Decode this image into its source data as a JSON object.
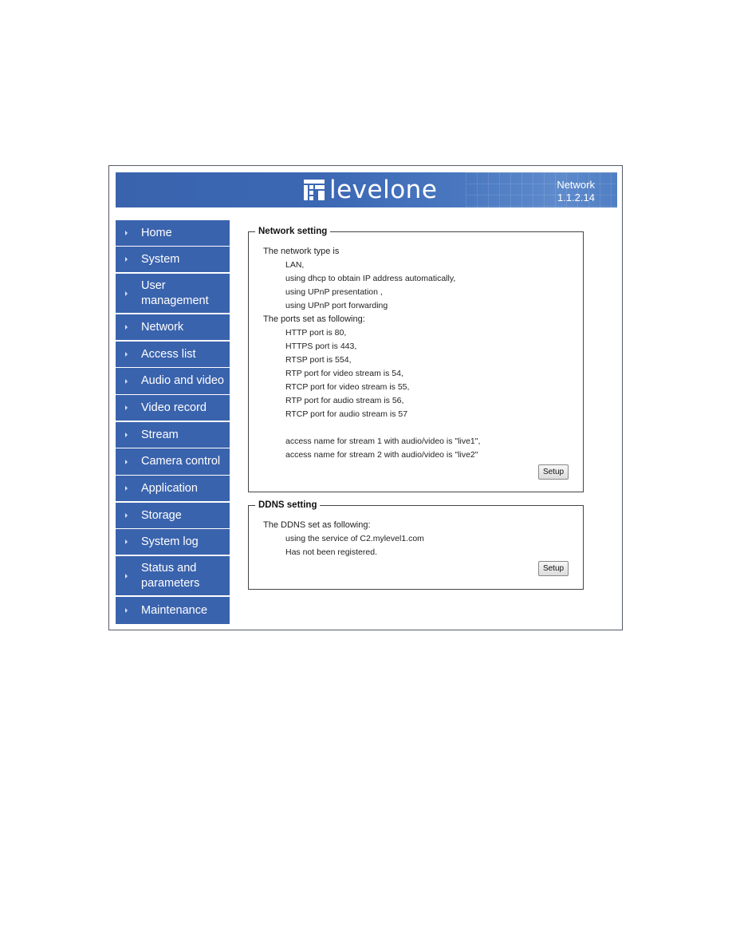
{
  "header": {
    "brand": "levelone",
    "section": "Network",
    "version": "1.1.2.14"
  },
  "sidebar": {
    "items": [
      {
        "label": "Home"
      },
      {
        "label": "System"
      },
      {
        "label": "User management"
      },
      {
        "label": "Network"
      },
      {
        "label": "Access list"
      },
      {
        "label": "Audio and video"
      },
      {
        "label": "Video record"
      },
      {
        "label": "Stream"
      },
      {
        "label": "Camera control"
      },
      {
        "label": "Application"
      },
      {
        "label": "Storage"
      },
      {
        "label": "System log"
      },
      {
        "label": "Status and parameters"
      },
      {
        "label": "Maintenance"
      }
    ]
  },
  "network_setting": {
    "title": "Network setting",
    "type_heading": "The network type is",
    "type_lines": [
      "LAN,",
      "using dhcp to obtain IP address automatically,",
      "using UPnP presentation ,",
      "using UPnP port forwarding"
    ],
    "ports_heading": "The ports set as following:",
    "port_lines": [
      "HTTP port is 80,",
      "HTTPS port is 443,",
      "RTSP port is 554,",
      "RTP port for video stream is 54,",
      "RTCP port for video stream is 55,",
      "RTP port for audio stream is 56,",
      "RTCP port for audio stream is 57"
    ],
    "access_lines": [
      "access name for stream 1 with audio/video is \"live1\",",
      "access name for stream 2 with audio/video is \"live2\""
    ],
    "setup_label": "Setup"
  },
  "ddns_setting": {
    "title": "DDNS setting",
    "heading": "The DDNS set as following:",
    "lines": [
      "using the service of C2.mylevel1.com",
      "Has not been registered."
    ],
    "setup_label": "Setup"
  },
  "colors": {
    "nav_bg": "#3a63ad",
    "banner_bg": "#3b67b3"
  }
}
